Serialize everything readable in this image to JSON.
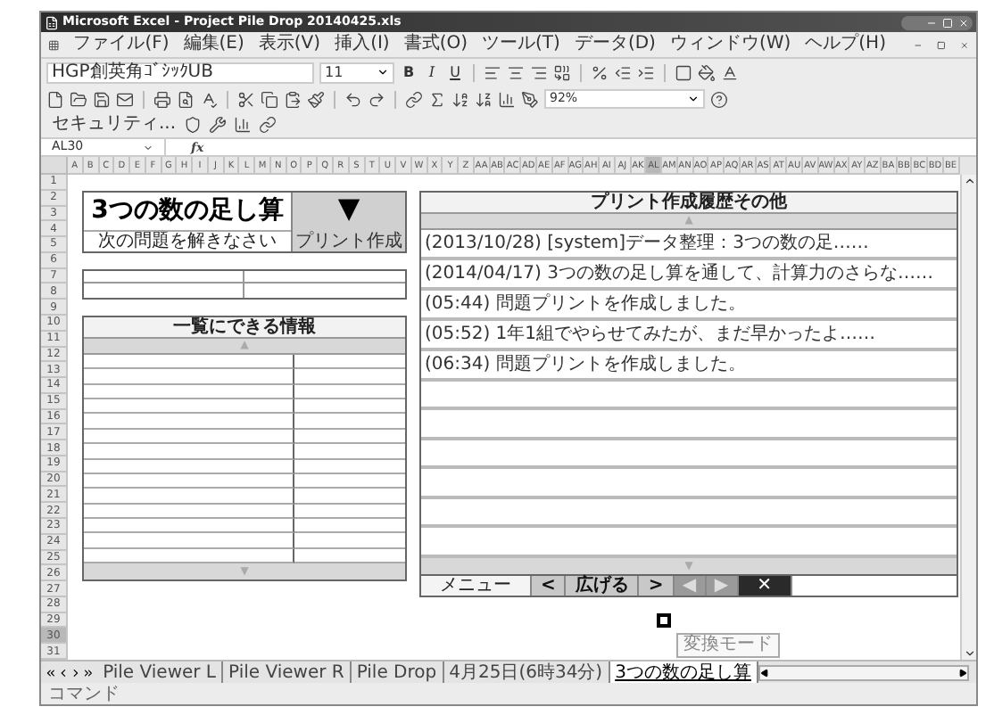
{
  "window": {
    "title": "Microsoft Excel - Project Pile Drop 20140425.xls"
  },
  "menu": [
    "ファイル(F)",
    "編集(E)",
    "表示(V)",
    "挿入(I)",
    "書式(O)",
    "ツール(T)",
    "データ(D)",
    "ウィンドウ(W)",
    "ヘルプ(H)"
  ],
  "format_toolbar": {
    "font": "HGP創英角ｺﾞｼｯｸUB",
    "size": "11",
    "bold": "B",
    "italic": "I",
    "underline": "U"
  },
  "standard_toolbar": {
    "zoom": "92%"
  },
  "security_toolbar": {
    "label": "セキュリティ..."
  },
  "formula_bar": {
    "name_box": "AL30",
    "fx": "fx"
  },
  "columns": [
    {
      "label": "A",
      "selected": false
    },
    {
      "label": "B",
      "selected": false
    },
    {
      "label": "C",
      "selected": false
    },
    {
      "label": "D",
      "selected": false
    },
    {
      "label": "E",
      "selected": false
    },
    {
      "label": "F",
      "selected": false
    },
    {
      "label": "G",
      "selected": false
    },
    {
      "label": "H",
      "selected": false
    },
    {
      "label": "I",
      "selected": false
    },
    {
      "label": "J",
      "selected": false
    },
    {
      "label": "K",
      "selected": false
    },
    {
      "label": "L",
      "selected": false
    },
    {
      "label": "M",
      "selected": false
    },
    {
      "label": "N",
      "selected": false
    },
    {
      "label": "O",
      "selected": false
    },
    {
      "label": "P",
      "selected": false
    },
    {
      "label": "Q",
      "selected": false
    },
    {
      "label": "R",
      "selected": false
    },
    {
      "label": "S",
      "selected": false
    },
    {
      "label": "T",
      "selected": false
    },
    {
      "label": "U",
      "selected": false
    },
    {
      "label": "V",
      "selected": false
    },
    {
      "label": "W",
      "selected": false
    },
    {
      "label": "X",
      "selected": false
    },
    {
      "label": "Y",
      "selected": false
    },
    {
      "label": "Z",
      "selected": false
    },
    {
      "label": "AA",
      "selected": false
    },
    {
      "label": "AB",
      "selected": false
    },
    {
      "label": "AC",
      "selected": false
    },
    {
      "label": "AD",
      "selected": false
    },
    {
      "label": "AE",
      "selected": false
    },
    {
      "label": "AF",
      "selected": false
    },
    {
      "label": "AG",
      "selected": false
    },
    {
      "label": "AH",
      "selected": false
    },
    {
      "label": "AI",
      "selected": false
    },
    {
      "label": "AJ",
      "selected": false
    },
    {
      "label": "AK",
      "selected": false
    },
    {
      "label": "AL",
      "selected": true
    },
    {
      "label": "AM",
      "selected": false
    },
    {
      "label": "AN",
      "selected": false
    },
    {
      "label": "AO",
      "selected": false
    },
    {
      "label": "AP",
      "selected": false
    },
    {
      "label": "AQ",
      "selected": false
    },
    {
      "label": "AR",
      "selected": false
    },
    {
      "label": "AS",
      "selected": false
    },
    {
      "label": "AT",
      "selected": false
    },
    {
      "label": "AU",
      "selected": false
    },
    {
      "label": "AV",
      "selected": false
    },
    {
      "label": "AW",
      "selected": false
    },
    {
      "label": "AX",
      "selected": false
    },
    {
      "label": "AY",
      "selected": false
    },
    {
      "label": "AZ",
      "selected": false
    },
    {
      "label": "BA",
      "selected": false
    },
    {
      "label": "BB",
      "selected": false
    },
    {
      "label": "BC",
      "selected": false
    },
    {
      "label": "BD",
      "selected": false
    },
    {
      "label": "BE",
      "selected": false
    }
  ],
  "rows": [
    {
      "label": "1",
      "selected": false
    },
    {
      "label": "2",
      "selected": false
    },
    {
      "label": "3",
      "selected": false
    },
    {
      "label": "4",
      "selected": false
    },
    {
      "label": "5",
      "selected": false
    },
    {
      "label": "6",
      "selected": false
    },
    {
      "label": "7",
      "selected": false
    },
    {
      "label": "8",
      "selected": false
    },
    {
      "label": "9",
      "selected": false
    },
    {
      "label": "10",
      "selected": false
    },
    {
      "label": "11",
      "selected": false
    },
    {
      "label": "12",
      "selected": false
    },
    {
      "label": "13",
      "selected": false
    },
    {
      "label": "14",
      "selected": false
    },
    {
      "label": "15",
      "selected": false
    },
    {
      "label": "16",
      "selected": false
    },
    {
      "label": "17",
      "selected": false
    },
    {
      "label": "18",
      "selected": false
    },
    {
      "label": "19",
      "selected": false
    },
    {
      "label": "20",
      "selected": false
    },
    {
      "label": "21",
      "selected": false
    },
    {
      "label": "22",
      "selected": false
    },
    {
      "label": "23",
      "selected": false
    },
    {
      "label": "24",
      "selected": false
    },
    {
      "label": "25",
      "selected": false
    },
    {
      "label": "26",
      "selected": false
    },
    {
      "label": "27",
      "selected": false
    },
    {
      "label": "28",
      "selected": false
    },
    {
      "label": "29",
      "selected": false
    },
    {
      "label": "30",
      "selected": true
    },
    {
      "label": "31",
      "selected": false
    }
  ],
  "left_panel": {
    "title": "3つの数の足し算",
    "print_button": {
      "icon": "▼",
      "label": "プリント作成"
    },
    "subtitle": "次の問題を解きなさい",
    "list_header": "一覧にできる情報",
    "scroll_up": "▲",
    "scroll_down": "▼"
  },
  "right_panel": {
    "header": "プリント作成履歴その他",
    "scroll_up": "▲",
    "entries": [
      "(2013/10/28) [system]データ整理：3つの数の足……",
      "(2014/04/17) 3つの数の足し算を通して、計算力のさらな……",
      "(05:44) 問題プリントを作成しました。",
      "(05:52) 1年1組でやらせてみたが、まだ早かったよ……",
      "(06:34) 問題プリントを作成しました。"
    ],
    "scroll_down": "▼",
    "buttons": [
      {
        "kind": "plain",
        "label": "メニュー"
      },
      {
        "kind": "nav",
        "label": "<"
      },
      {
        "kind": "nav",
        "label": "広げる"
      },
      {
        "kind": "nav",
        "label": ">"
      },
      {
        "kind": "icon",
        "label": "◀"
      },
      {
        "kind": "icon",
        "label": "▶"
      },
      {
        "kind": "close",
        "label": "✕"
      }
    ]
  },
  "sheet_tabs": [
    {
      "label": "Pile Viewer L",
      "selected": false
    },
    {
      "label": "Pile Viewer R",
      "selected": false
    },
    {
      "label": "Pile Drop",
      "selected": false
    },
    {
      "label": "4月25日(6時34分)",
      "selected": false
    },
    {
      "label": "3つの数の足し算",
      "selected": true
    }
  ],
  "ime": {
    "tooltip": "変換モード"
  },
  "status_bar": {
    "text": "コマンド"
  }
}
